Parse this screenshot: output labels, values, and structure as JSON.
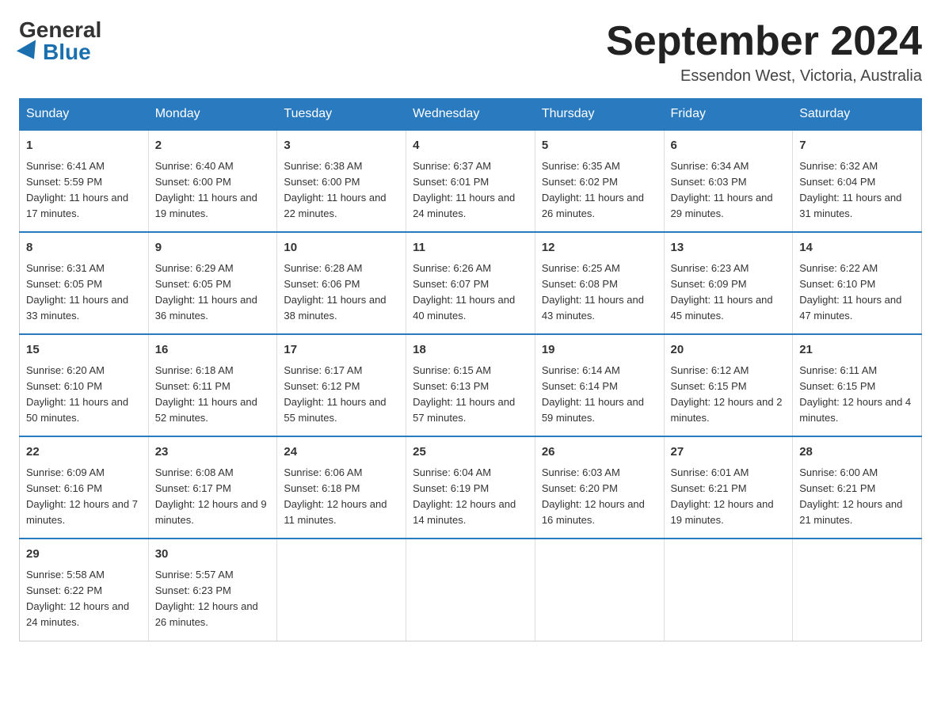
{
  "header": {
    "logo_general": "General",
    "logo_blue": "Blue",
    "month_title": "September 2024",
    "location": "Essendon West, Victoria, Australia"
  },
  "days_of_week": [
    "Sunday",
    "Monday",
    "Tuesday",
    "Wednesday",
    "Thursday",
    "Friday",
    "Saturday"
  ],
  "weeks": [
    [
      {
        "day": "1",
        "sunrise": "6:41 AM",
        "sunset": "5:59 PM",
        "daylight": "11 hours and 17 minutes."
      },
      {
        "day": "2",
        "sunrise": "6:40 AM",
        "sunset": "6:00 PM",
        "daylight": "11 hours and 19 minutes."
      },
      {
        "day": "3",
        "sunrise": "6:38 AM",
        "sunset": "6:00 PM",
        "daylight": "11 hours and 22 minutes."
      },
      {
        "day": "4",
        "sunrise": "6:37 AM",
        "sunset": "6:01 PM",
        "daylight": "11 hours and 24 minutes."
      },
      {
        "day": "5",
        "sunrise": "6:35 AM",
        "sunset": "6:02 PM",
        "daylight": "11 hours and 26 minutes."
      },
      {
        "day": "6",
        "sunrise": "6:34 AM",
        "sunset": "6:03 PM",
        "daylight": "11 hours and 29 minutes."
      },
      {
        "day": "7",
        "sunrise": "6:32 AM",
        "sunset": "6:04 PM",
        "daylight": "11 hours and 31 minutes."
      }
    ],
    [
      {
        "day": "8",
        "sunrise": "6:31 AM",
        "sunset": "6:05 PM",
        "daylight": "11 hours and 33 minutes."
      },
      {
        "day": "9",
        "sunrise": "6:29 AM",
        "sunset": "6:05 PM",
        "daylight": "11 hours and 36 minutes."
      },
      {
        "day": "10",
        "sunrise": "6:28 AM",
        "sunset": "6:06 PM",
        "daylight": "11 hours and 38 minutes."
      },
      {
        "day": "11",
        "sunrise": "6:26 AM",
        "sunset": "6:07 PM",
        "daylight": "11 hours and 40 minutes."
      },
      {
        "day": "12",
        "sunrise": "6:25 AM",
        "sunset": "6:08 PM",
        "daylight": "11 hours and 43 minutes."
      },
      {
        "day": "13",
        "sunrise": "6:23 AM",
        "sunset": "6:09 PM",
        "daylight": "11 hours and 45 minutes."
      },
      {
        "day": "14",
        "sunrise": "6:22 AM",
        "sunset": "6:10 PM",
        "daylight": "11 hours and 47 minutes."
      }
    ],
    [
      {
        "day": "15",
        "sunrise": "6:20 AM",
        "sunset": "6:10 PM",
        "daylight": "11 hours and 50 minutes."
      },
      {
        "day": "16",
        "sunrise": "6:18 AM",
        "sunset": "6:11 PM",
        "daylight": "11 hours and 52 minutes."
      },
      {
        "day": "17",
        "sunrise": "6:17 AM",
        "sunset": "6:12 PM",
        "daylight": "11 hours and 55 minutes."
      },
      {
        "day": "18",
        "sunrise": "6:15 AM",
        "sunset": "6:13 PM",
        "daylight": "11 hours and 57 minutes."
      },
      {
        "day": "19",
        "sunrise": "6:14 AM",
        "sunset": "6:14 PM",
        "daylight": "11 hours and 59 minutes."
      },
      {
        "day": "20",
        "sunrise": "6:12 AM",
        "sunset": "6:15 PM",
        "daylight": "12 hours and 2 minutes."
      },
      {
        "day": "21",
        "sunrise": "6:11 AM",
        "sunset": "6:15 PM",
        "daylight": "12 hours and 4 minutes."
      }
    ],
    [
      {
        "day": "22",
        "sunrise": "6:09 AM",
        "sunset": "6:16 PM",
        "daylight": "12 hours and 7 minutes."
      },
      {
        "day": "23",
        "sunrise": "6:08 AM",
        "sunset": "6:17 PM",
        "daylight": "12 hours and 9 minutes."
      },
      {
        "day": "24",
        "sunrise": "6:06 AM",
        "sunset": "6:18 PM",
        "daylight": "12 hours and 11 minutes."
      },
      {
        "day": "25",
        "sunrise": "6:04 AM",
        "sunset": "6:19 PM",
        "daylight": "12 hours and 14 minutes."
      },
      {
        "day": "26",
        "sunrise": "6:03 AM",
        "sunset": "6:20 PM",
        "daylight": "12 hours and 16 minutes."
      },
      {
        "day": "27",
        "sunrise": "6:01 AM",
        "sunset": "6:21 PM",
        "daylight": "12 hours and 19 minutes."
      },
      {
        "day": "28",
        "sunrise": "6:00 AM",
        "sunset": "6:21 PM",
        "daylight": "12 hours and 21 minutes."
      }
    ],
    [
      {
        "day": "29",
        "sunrise": "5:58 AM",
        "sunset": "6:22 PM",
        "daylight": "12 hours and 24 minutes."
      },
      {
        "day": "30",
        "sunrise": "5:57 AM",
        "sunset": "6:23 PM",
        "daylight": "12 hours and 26 minutes."
      },
      {
        "day": "",
        "sunrise": "",
        "sunset": "",
        "daylight": ""
      },
      {
        "day": "",
        "sunrise": "",
        "sunset": "",
        "daylight": ""
      },
      {
        "day": "",
        "sunrise": "",
        "sunset": "",
        "daylight": ""
      },
      {
        "day": "",
        "sunrise": "",
        "sunset": "",
        "daylight": ""
      },
      {
        "day": "",
        "sunrise": "",
        "sunset": "",
        "daylight": ""
      }
    ]
  ]
}
